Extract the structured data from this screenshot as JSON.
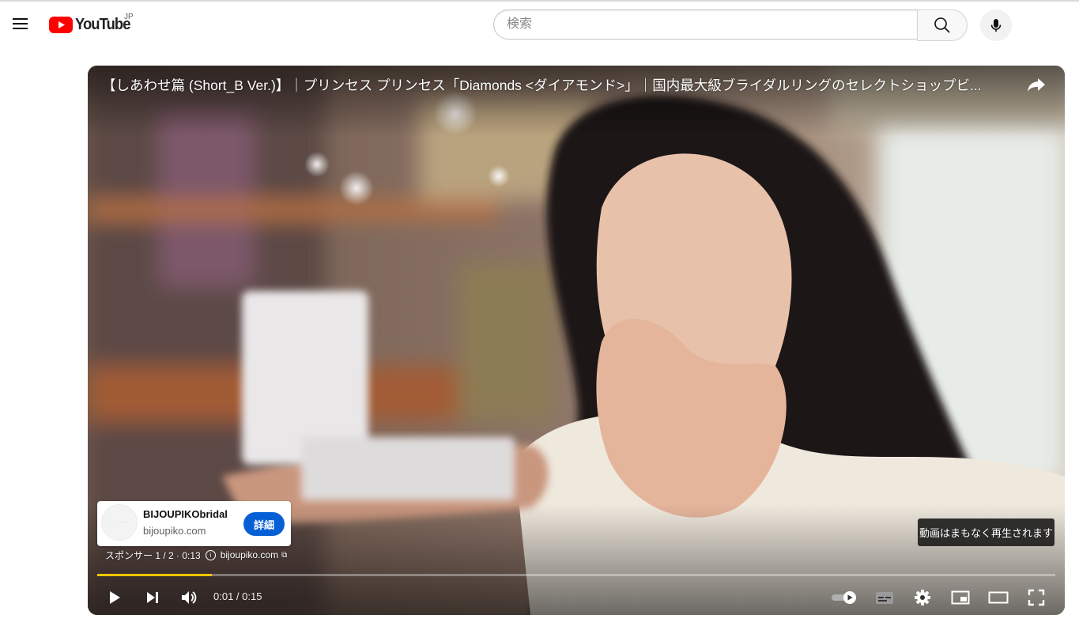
{
  "masthead": {
    "logo_text": "YouTube",
    "region": "JP",
    "search": {
      "placeholder": "検索",
      "value": ""
    }
  },
  "player": {
    "title": "【しあわせ篇 (Short_B Ver.)】｜プリンセス プリンセス「Diamonds <ダイアモンド>」｜国内最大級ブライダルリングのセレクトショップビ...",
    "ad": {
      "advertiser": "BIJOUPIKObridal",
      "domain": "bijoupiko.com",
      "cta_label": "詳細",
      "sponsor_label": "スポンサー 1 / 2 · 0:13",
      "link_text": "bijoupiko.com"
    },
    "skip_notice": "動画はまもなく再生されます",
    "progress": 0.12,
    "time": "0:01 / 0:15",
    "icons": [
      "play-icon",
      "next-icon",
      "volume-icon",
      "autoplay-toggle-icon",
      "subtitles-icon",
      "settings-icon",
      "miniplayer-icon",
      "theater-icon",
      "fullscreen-icon",
      "share-icon"
    ],
    "colors": {
      "progress": "#f5c600",
      "cta": "#065fd4",
      "logo_red": "#ff0000"
    }
  }
}
